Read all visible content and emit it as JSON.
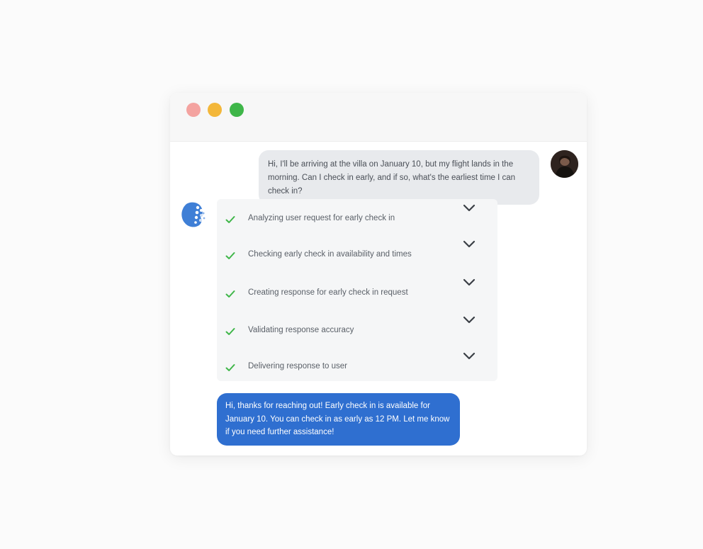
{
  "window": {
    "controls": [
      "close",
      "minimize",
      "maximize"
    ],
    "colors": {
      "close": "#f4a3a0",
      "minimize": "#f3b73a",
      "maximize": "#3fb649"
    }
  },
  "chat": {
    "user_message": "Hi, I'll be arriving at the villa on January 10, but my flight lands in the morning. Can I check in early, and if so, what's the earliest time I can check in?",
    "user_avatar_icon": "user-avatar",
    "bot_avatar_icon": "bot-logo-icon",
    "steps": [
      {
        "label": "Analyzing user request for early check in",
        "status": "done"
      },
      {
        "label": "Checking early check in availability and times",
        "status": "done"
      },
      {
        "label": "Creating response for early check in request",
        "status": "done"
      },
      {
        "label": "Validating response accuracy",
        "status": "done"
      },
      {
        "label": "Delivering response to user",
        "status": "done"
      }
    ],
    "bot_reply": "Hi, thanks for reaching out! Early check in is available for January 10. You can check in as early as 12 PM. Let me know if you need further assistance!",
    "colors": {
      "accent": "#2f6fd0",
      "check": "#3fb649",
      "user_bubble": "#e8eaed"
    }
  }
}
